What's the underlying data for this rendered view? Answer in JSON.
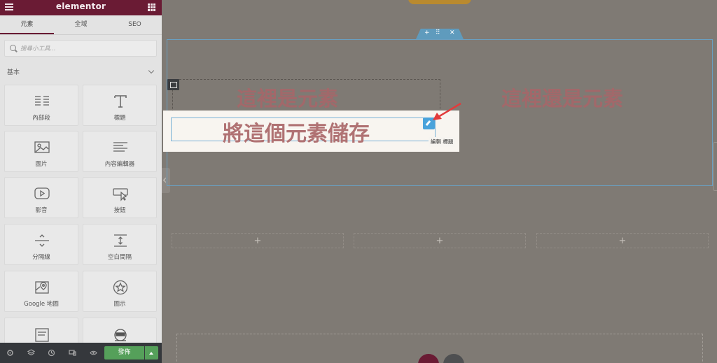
{
  "app": {
    "logo": "elementor",
    "brand_color": "#6a1b34"
  },
  "tabs": [
    {
      "label": "元素",
      "active": true
    },
    {
      "label": "全域",
      "active": false
    },
    {
      "label": "SEO",
      "active": false
    }
  ],
  "search": {
    "placeholder": "搜尋小工具..."
  },
  "section": {
    "title": "基本"
  },
  "widgets": [
    {
      "label": "內部段",
      "icon": "inner-section-icon"
    },
    {
      "label": "標題",
      "icon": "heading-icon"
    },
    {
      "label": "圖片",
      "icon": "image-icon"
    },
    {
      "label": "內容編輯器",
      "icon": "text-editor-icon"
    },
    {
      "label": "影音",
      "icon": "video-icon"
    },
    {
      "label": "按鈕",
      "icon": "button-icon"
    },
    {
      "label": "分隔線",
      "icon": "divider-icon"
    },
    {
      "label": "空白間隔",
      "icon": "spacer-icon"
    },
    {
      "label": "Google 地圖",
      "icon": "map-icon"
    },
    {
      "label": "圖示",
      "icon": "star-icon"
    },
    {
      "label": "",
      "icon": "form-icon"
    },
    {
      "label": "",
      "icon": "ninja-icon"
    }
  ],
  "footer": {
    "publish_label": "發佈"
  },
  "canvas": {
    "heading_left": "這裡是元素",
    "heading_right": "這裡還是元素",
    "heading_selected": "將這個元素儲存",
    "edit_tooltip": "編輯 標題",
    "add_symbol": "+"
  }
}
